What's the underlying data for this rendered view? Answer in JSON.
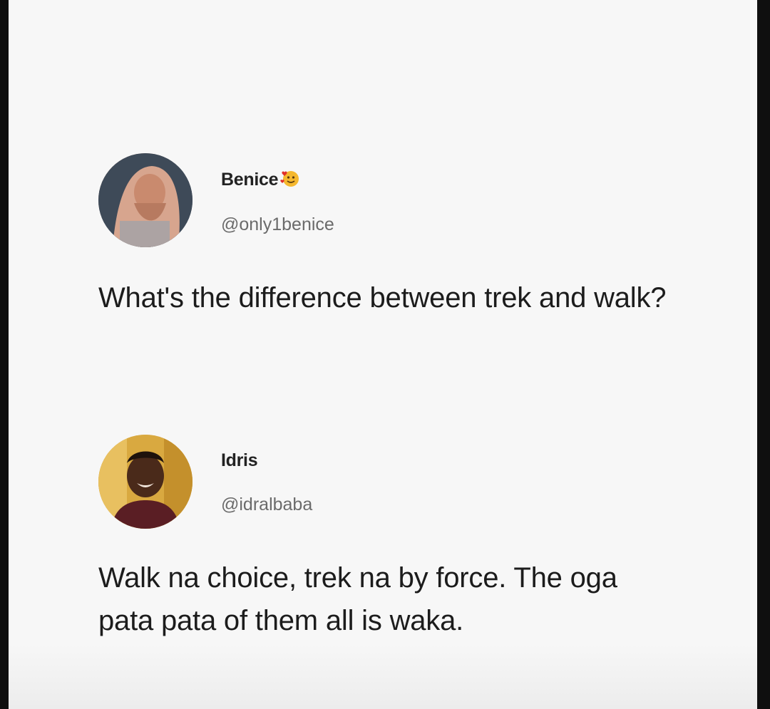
{
  "tweets": [
    {
      "name": "Benice",
      "name_emoji": "smiling-face-with-hearts-emoji",
      "handle": "@only1benice",
      "text": "What's the difference between trek and walk?"
    },
    {
      "name": "Idris",
      "handle": "@idralbaba",
      "text": "Walk na choice, trek na by force. The oga pata pata of them all is waka."
    }
  ],
  "colors": {
    "background": "#f7f7f7",
    "text": "#1c1c1c",
    "handle": "#6b6b6b",
    "frame": "#0f0f0f"
  }
}
